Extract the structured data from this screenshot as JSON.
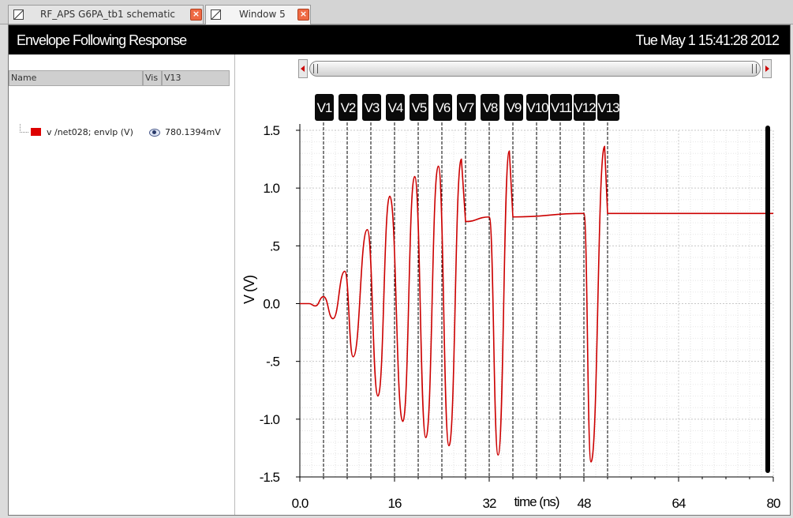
{
  "tabs": [
    {
      "label": "RF_APS G6PA_tb1 schematic",
      "active": false
    },
    {
      "label": "Window 5",
      "active": true
    }
  ],
  "window": {
    "title": "Envelope Following Response",
    "datetime": "Tue May 1 15:41:28 2012"
  },
  "signal_table": {
    "headers": [
      "Name",
      "Vis",
      "V13"
    ],
    "rows": [
      {
        "name": "v /net028; envlp (V)",
        "color": "#dd0000",
        "value": "780.1394mV",
        "visible_icon": "eye-icon"
      }
    ]
  },
  "markers": [
    {
      "label": "V1",
      "x": 4
    },
    {
      "label": "V2",
      "x": 8
    },
    {
      "label": "V3",
      "x": 12
    },
    {
      "label": "V4",
      "x": 16
    },
    {
      "label": "V5",
      "x": 20
    },
    {
      "label": "V6",
      "x": 24
    },
    {
      "label": "V7",
      "x": 28
    },
    {
      "label": "V8",
      "x": 32
    },
    {
      "label": "V9",
      "x": 36
    },
    {
      "label": "V10",
      "x": 40
    },
    {
      "label": "V11",
      "x": 44
    },
    {
      "label": "V12",
      "x": 48
    },
    {
      "label": "V13",
      "x": 52
    }
  ],
  "chart_data": {
    "type": "line",
    "xlabel": "time (ns)",
    "ylabel": "V (V)",
    "xlim": [
      0,
      80
    ],
    "ylim": [
      -1.5,
      1.5
    ],
    "xticks": [
      0,
      16,
      32,
      48,
      64,
      80
    ],
    "xtick_labels": [
      "0.0",
      "16",
      "32",
      "48",
      "64",
      "80"
    ],
    "yticks": [
      1.5,
      1.0,
      0.5,
      0.0,
      -0.5,
      -1.0,
      -1.5
    ],
    "ytick_labels": [
      "1.5",
      "1.0",
      ".5",
      "0.0",
      "-.5",
      "-1.0",
      "-1.5"
    ],
    "grid": true,
    "line_color": "#cc0000",
    "series": [
      {
        "name": "v /net028; envlp (V)",
        "x": [
          0,
          1.6,
          2.6,
          4.0,
          5.6,
          7.6,
          9.0,
          11.4,
          13.2,
          15.2,
          17.4,
          19.4,
          21.3,
          23.4,
          25.2,
          27.3,
          28.0,
          32.0,
          33.5,
          35.4,
          36.0,
          48.0,
          49.2,
          51.5,
          52.0,
          80.0
        ],
        "y": [
          0.0,
          0.0,
          -0.02,
          0.06,
          -0.13,
          0.28,
          -0.46,
          0.64,
          -0.8,
          0.93,
          -1.02,
          1.1,
          -1.16,
          1.19,
          -1.23,
          1.25,
          0.71,
          0.75,
          -1.31,
          1.32,
          0.75,
          0.78,
          -1.37,
          1.36,
          0.78,
          0.78
        ]
      }
    ]
  }
}
